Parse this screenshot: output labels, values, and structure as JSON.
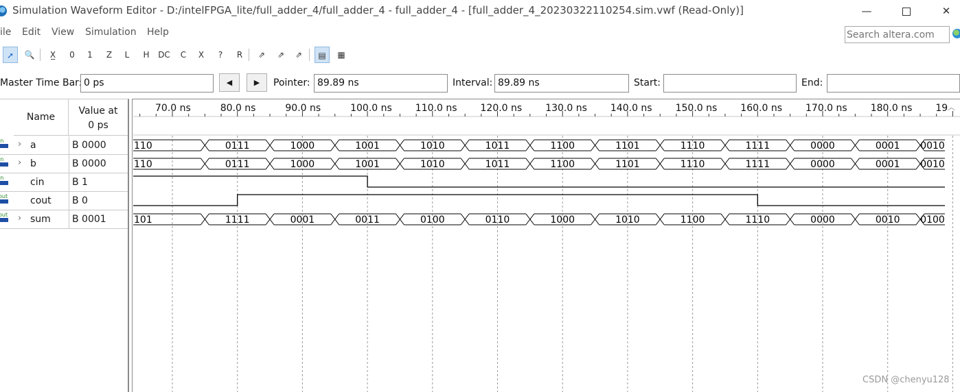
{
  "window": {
    "title": "Simulation Waveform Editor - D:/intelFPGA_lite/full_adder_4/full_adder_4 - full_adder_4 - [full_adder_4_20230322110254.sim.vwf (Read-Only)]",
    "minimize": "—",
    "close": "✕"
  },
  "menu": [
    "ile",
    "Edit",
    "View",
    "Simulation",
    "Help"
  ],
  "search": {
    "placeholder": "Search altera.com"
  },
  "toolbar": {
    "buttons": [
      {
        "name": "selection-tool-icon",
        "glyph": "➚"
      },
      {
        "name": "zoom-tool-icon",
        "glyph": "🔍"
      },
      {
        "name": "force-unknown-icon",
        "glyph": "X̲"
      },
      {
        "name": "force-low-icon",
        "glyph": "0"
      },
      {
        "name": "force-high-icon",
        "glyph": "1"
      },
      {
        "name": "high-impedance-icon",
        "glyph": "Z"
      },
      {
        "name": "weak-low-icon",
        "glyph": "L"
      },
      {
        "name": "weak-high-icon",
        "glyph": "H"
      },
      {
        "name": "dont-care-icon",
        "glyph": "DC"
      },
      {
        "name": "invert-icon",
        "glyph": "C"
      },
      {
        "name": "count-value-icon",
        "glyph": "X"
      },
      {
        "name": "arbitrary-value-icon",
        "glyph": "?"
      },
      {
        "name": "random-value-icon",
        "glyph": "R"
      },
      {
        "name": "functional-simulation-icon",
        "glyph": "⇗"
      },
      {
        "name": "timing-simulation-icon",
        "glyph": "⇗"
      },
      {
        "name": "netlist-generation-icon",
        "glyph": "⇗"
      },
      {
        "name": "snap-to-grid-icon",
        "glyph": "▤"
      },
      {
        "name": "grid-settings-icon",
        "glyph": "▦"
      }
    ]
  },
  "timebar": {
    "master_label": "Master Time Bar:",
    "master_value": "0 ps",
    "pointer_label": "Pointer:",
    "pointer_value": "89.89 ns",
    "interval_label": "Interval:",
    "interval_value": "89.89 ns",
    "start_label": "Start:",
    "start_value": "",
    "end_label": "End:",
    "end_value": "",
    "prev_arrow": "◀",
    "next_arrow": "▶"
  },
  "signals_header": {
    "name": "Name",
    "value_line1": "Value at",
    "value_line2": "0 ps"
  },
  "signals": [
    {
      "name": "a",
      "value": "B 0000",
      "type": "bus",
      "expandable": true,
      "icon": "in"
    },
    {
      "name": "b",
      "value": "B 0000",
      "type": "bus",
      "expandable": true,
      "icon": "in"
    },
    {
      "name": "cin",
      "value": "B 1",
      "type": "bit",
      "expandable": false,
      "icon": "in"
    },
    {
      "name": "cout",
      "value": "B 0",
      "type": "bit",
      "expandable": false,
      "icon": "out"
    },
    {
      "name": "sum",
      "value": "B 0001",
      "type": "bus",
      "expandable": true,
      "icon": "out"
    }
  ],
  "ruler": {
    "labels": [
      "70.0 ns",
      "80.0 ns",
      "90.0 ns",
      "100.0 ns",
      "110.0 ns",
      "120.0 ns",
      "130.0 ns",
      "140.0 ns",
      "150.0 ns",
      "160.0 ns",
      "170.0 ns",
      "180.0 ns",
      "19"
    ]
  },
  "waveforms": {
    "a": [
      "110",
      "0111",
      "1000",
      "1001",
      "1010",
      "1011",
      "1100",
      "1101",
      "1110",
      "1111",
      "0000",
      "0001",
      "0010"
    ],
    "b": [
      "110",
      "0111",
      "1000",
      "1001",
      "1010",
      "1011",
      "1100",
      "1101",
      "1110",
      "1111",
      "0000",
      "0001",
      "0010"
    ],
    "cin": {
      "high_from_ns": 60,
      "high_to_ns": 100,
      "low_after": true
    },
    "cout": {
      "low_until_ns": 80,
      "high_from_ns": 80,
      "high_to_ns": 160
    },
    "sum": [
      "101",
      "1111",
      "0001",
      "0011",
      "0100",
      "0110",
      "1000",
      "1010",
      "1100",
      "1110",
      "0000",
      "0010",
      "0100"
    ]
  },
  "watermark": "CSDN @chenyu128"
}
